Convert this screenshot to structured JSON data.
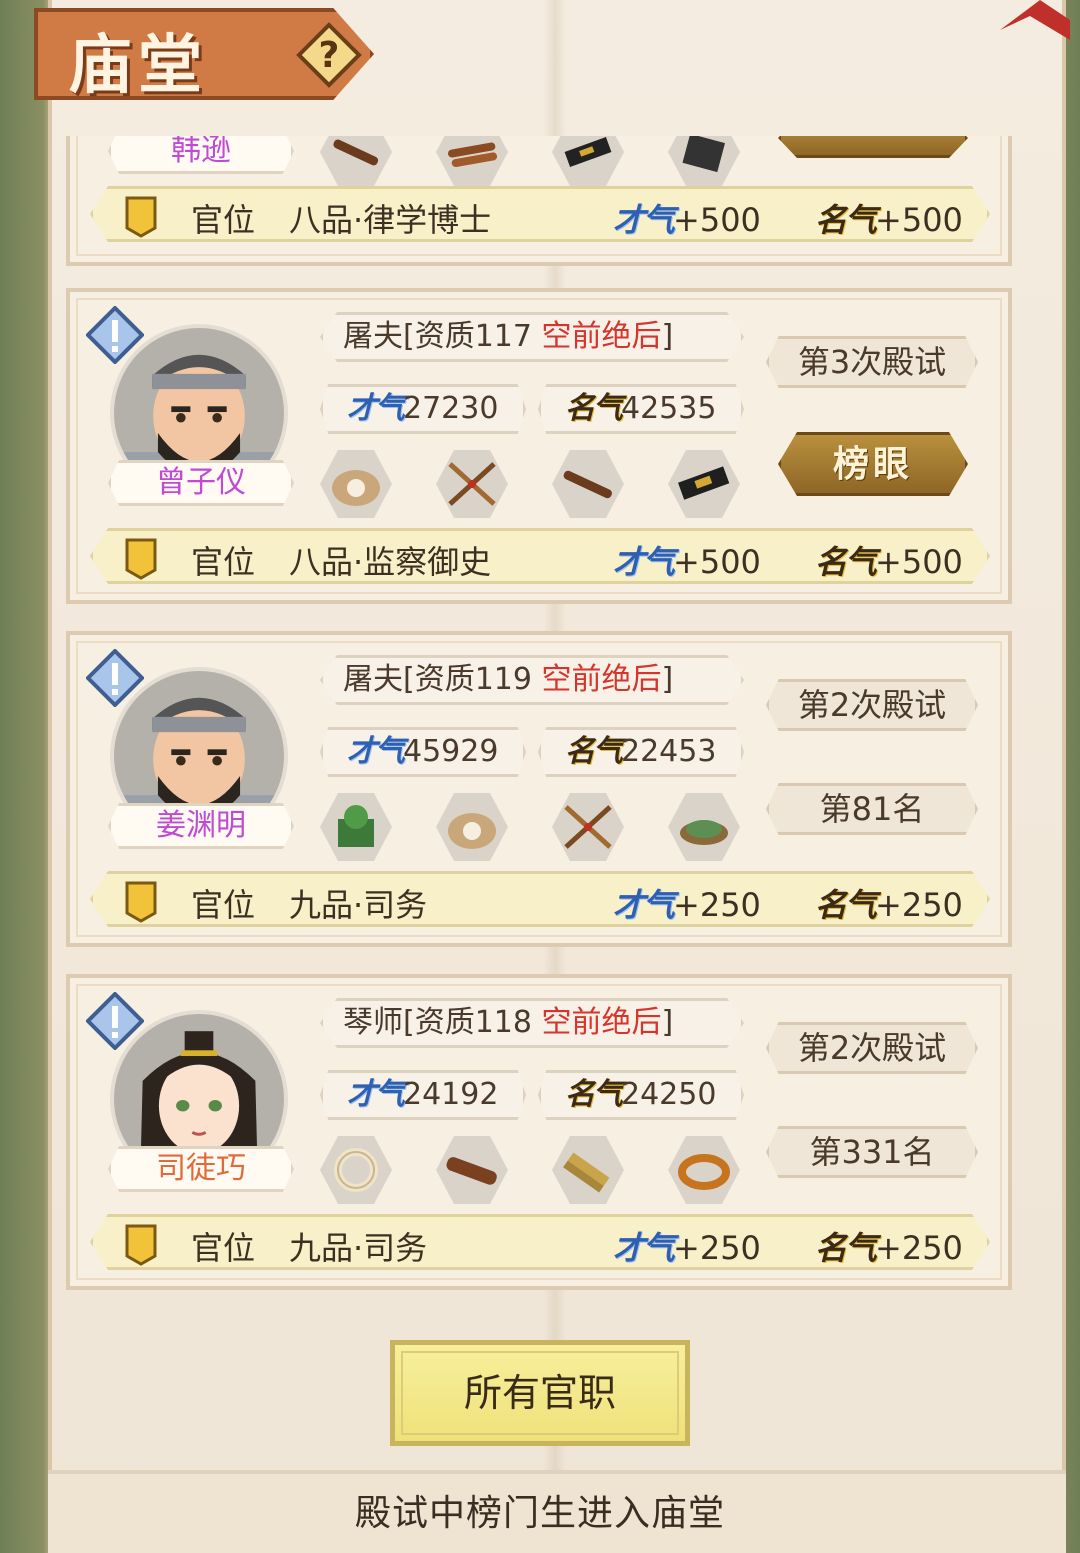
{
  "header": {
    "title": "庙堂",
    "help_icon": "question-icon"
  },
  "top_partial": {
    "name": "韩逊",
    "office_label": "官位",
    "office": "八品·律学博士",
    "bonus_cai": "+500",
    "bonus_ming": "+500"
  },
  "stat_labels": {
    "cai": "才气",
    "ming": "名气"
  },
  "cards": [
    {
      "name": "曾子仪",
      "profession": "屠夫[资质117",
      "rarity": "空前绝后",
      "close": "]",
      "cai": "27230",
      "ming": "42535",
      "exam": "第3次殿试",
      "rank": "榜眼",
      "items": [
        "pearl-shell-icon",
        "crossed-swords-icon",
        "flute-icon",
        "inkstick-icon"
      ],
      "office_label": "官位",
      "office": "八品·监察御史",
      "bonus_cai": "+500",
      "bonus_ming": "+500"
    },
    {
      "name": "姜渊明",
      "profession": "屠夫[资质119",
      "rarity": "空前绝后",
      "close": "]",
      "cai": "45929",
      "ming": "22453",
      "exam": "第2次殿试",
      "rank": "第81名",
      "items": [
        "jade-seal-icon",
        "pearl-shell-icon",
        "crossed-swords-icon",
        "jade-ring-icon"
      ],
      "office_label": "官位",
      "office": "九品·司务",
      "bonus_cai": "+250",
      "bonus_ming": "+250"
    },
    {
      "name": "司徒巧",
      "profession": "琴师[资质118",
      "rarity": "空前绝后",
      "close": "]",
      "cai": "24192",
      "ming": "24250",
      "exam": "第2次殿试",
      "rank": "第331名",
      "items": [
        "bead-bracelet-icon",
        "guqin-icon",
        "bamboo-slips-icon",
        "bangle-icon"
      ],
      "office_label": "官位",
      "office": "九品·司务",
      "bonus_cai": "+250",
      "bonus_ming": "+250"
    }
  ],
  "buttons": {
    "all_offices": "所有官职"
  },
  "footer": {
    "hint": "殿试中榜门生进入庙堂"
  },
  "colors": {
    "rarity": "#d6342c",
    "name": "#c04ad3",
    "cai": "#2f5fb0",
    "ming_gold": "#e6b934",
    "banner": "#d07a45"
  }
}
